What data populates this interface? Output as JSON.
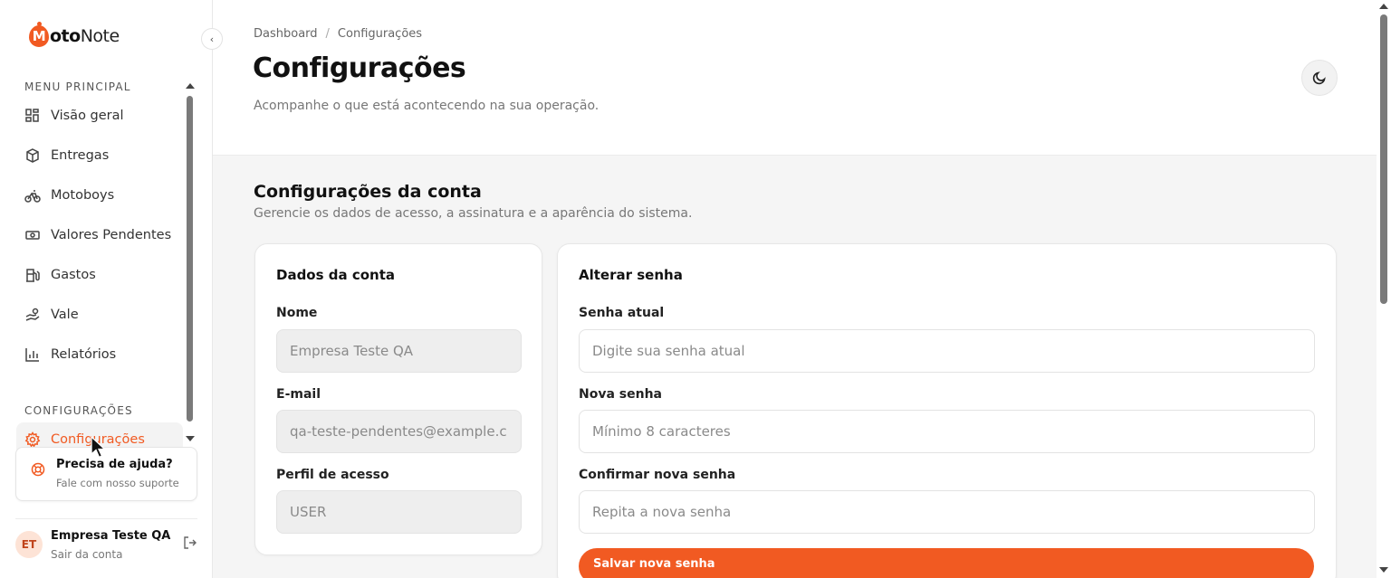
{
  "brand": {
    "logo_letter": "M",
    "logo_bold": "oto",
    "logo_rest": "Note",
    "accent": "#f15a22"
  },
  "sidebar": {
    "collapse_icon": "chevron-left-icon",
    "section_main": "MENU PRINCIPAL",
    "items": [
      {
        "label": "Visão geral",
        "icon": "dashboard-icon"
      },
      {
        "label": "Entregas",
        "icon": "package-icon"
      },
      {
        "label": "Motoboys",
        "icon": "bike-icon"
      },
      {
        "label": "Valores Pendentes",
        "icon": "banknote-icon"
      },
      {
        "label": "Gastos",
        "icon": "fuel-icon"
      },
      {
        "label": "Vale",
        "icon": "handcoins-icon"
      },
      {
        "label": "Relatórios",
        "icon": "bar-chart-icon"
      }
    ],
    "section_config": "CONFIGURAÇÕES",
    "config_item": {
      "label": "Configurações",
      "icon": "gear-icon"
    },
    "help": {
      "title": "Precisa de ajuda?",
      "subtitle": "Fale com nosso suporte"
    },
    "user": {
      "initials": "ET",
      "name": "Empresa Teste QA",
      "subtitle": "Sair da conta"
    }
  },
  "header": {
    "breadcrumb": [
      "Dashboard",
      "Configurações"
    ],
    "breadcrumb_sep": "/",
    "title": "Configurações",
    "subtitle": "Acompanhe o que está acontecendo na sua operação."
  },
  "content": {
    "title": "Configurações da conta",
    "subtitle": "Gerencie os dados de acesso, a assinatura e a aparência do sistema.",
    "account_card": {
      "title": "Dados da conta",
      "name_label": "Nome",
      "name_value": "Empresa Teste QA",
      "email_label": "E-mail",
      "email_value": "qa-teste-pendentes@example.c",
      "profile_label": "Perfil de acesso",
      "profile_value": "USER"
    },
    "password_card": {
      "title": "Alterar senha",
      "current_label": "Senha atual",
      "current_placeholder": "Digite sua senha atual",
      "new_label": "Nova senha",
      "new_placeholder": "Mínimo 8 caracteres",
      "confirm_label": "Confirmar nova senha",
      "confirm_placeholder": "Repita a nova senha",
      "save_label": "Salvar nova senha"
    }
  }
}
